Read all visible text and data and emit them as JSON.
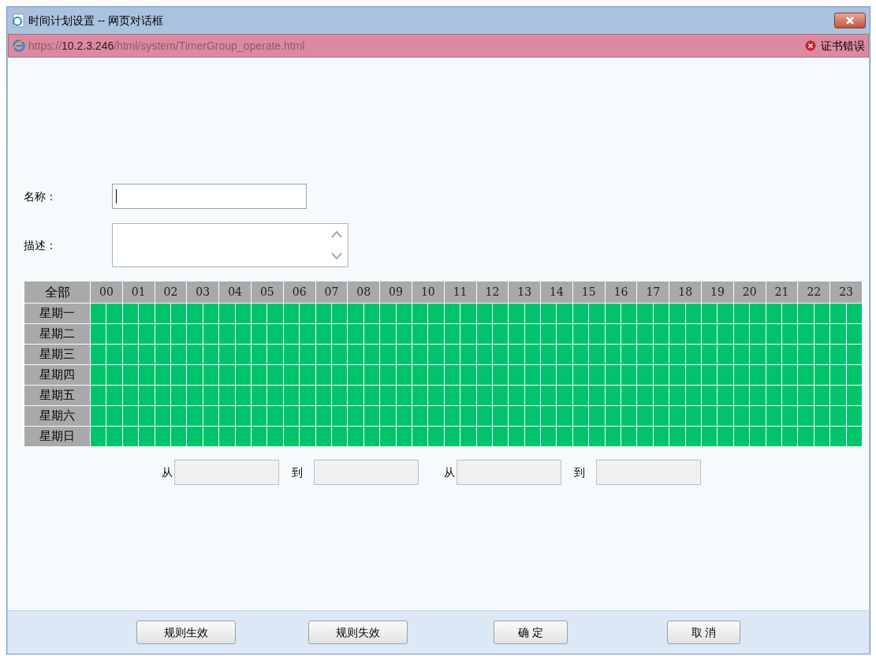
{
  "window": {
    "title": "时间计划设置 -- 网页对话框"
  },
  "address_bar": {
    "scheme": "https://",
    "host": "10.2.3.246",
    "path": "/html/system/TimerGroup_operate.html",
    "warning": "证书错误"
  },
  "form": {
    "name_label": "名称：",
    "name_focused": true,
    "description_label": "描述："
  },
  "schedule": {
    "corner": "全部",
    "hours": [
      "00",
      "01",
      "02",
      "03",
      "04",
      "05",
      "06",
      "07",
      "08",
      "09",
      "10",
      "11",
      "12",
      "13",
      "14",
      "15",
      "16",
      "17",
      "18",
      "19",
      "20",
      "21",
      "22",
      "23"
    ],
    "rows": [
      {
        "label": "星期一",
        "slots": [
          true,
          true,
          true,
          true,
          true,
          true,
          true,
          true,
          true,
          true,
          true,
          true,
          true,
          true,
          true,
          true,
          true,
          true,
          true,
          true,
          true,
          true,
          true,
          true,
          true,
          true,
          true,
          true,
          true,
          true,
          true,
          true,
          true,
          true,
          true,
          true,
          true,
          true,
          true,
          true,
          true,
          true,
          true,
          true,
          true,
          true,
          true,
          true
        ]
      },
      {
        "label": "星期二",
        "slots": [
          true,
          true,
          true,
          true,
          true,
          true,
          true,
          true,
          true,
          true,
          true,
          true,
          true,
          true,
          true,
          true,
          true,
          true,
          true,
          true,
          true,
          true,
          true,
          true,
          true,
          true,
          true,
          true,
          true,
          true,
          true,
          true,
          true,
          true,
          true,
          true,
          true,
          true,
          true,
          true,
          true,
          true,
          true,
          true,
          true,
          true,
          true,
          true
        ]
      },
      {
        "label": "星期三",
        "slots": [
          true,
          true,
          true,
          true,
          true,
          true,
          true,
          true,
          true,
          true,
          true,
          true,
          true,
          true,
          true,
          true,
          true,
          true,
          true,
          true,
          true,
          true,
          true,
          true,
          true,
          true,
          true,
          true,
          true,
          true,
          true,
          true,
          true,
          true,
          true,
          true,
          true,
          true,
          true,
          true,
          true,
          true,
          true,
          true,
          true,
          true,
          true,
          true
        ]
      },
      {
        "label": "星期四",
        "slots": [
          true,
          true,
          true,
          true,
          true,
          true,
          true,
          true,
          true,
          true,
          true,
          true,
          true,
          true,
          true,
          true,
          true,
          true,
          true,
          true,
          true,
          true,
          true,
          true,
          true,
          true,
          true,
          true,
          true,
          true,
          true,
          true,
          true,
          true,
          true,
          true,
          true,
          true,
          true,
          true,
          true,
          true,
          true,
          true,
          true,
          true,
          true,
          true
        ]
      },
      {
        "label": "星期五",
        "slots": [
          true,
          true,
          true,
          true,
          true,
          true,
          true,
          true,
          true,
          true,
          true,
          true,
          true,
          true,
          true,
          true,
          true,
          true,
          true,
          true,
          true,
          true,
          true,
          true,
          true,
          true,
          true,
          true,
          true,
          true,
          true,
          true,
          true,
          true,
          true,
          true,
          true,
          true,
          true,
          true,
          true,
          true,
          true,
          true,
          true,
          true,
          true,
          true
        ]
      },
      {
        "label": "星期六",
        "slots": [
          true,
          true,
          true,
          true,
          true,
          true,
          true,
          true,
          true,
          true,
          true,
          true,
          true,
          true,
          true,
          true,
          true,
          true,
          true,
          true,
          true,
          true,
          true,
          true,
          true,
          true,
          true,
          true,
          true,
          true,
          true,
          true,
          true,
          true,
          true,
          true,
          true,
          true,
          true,
          true,
          true,
          true,
          true,
          true,
          true,
          true,
          true,
          true
        ]
      },
      {
        "label": "星期日",
        "slots": [
          true,
          true,
          true,
          true,
          true,
          true,
          true,
          true,
          true,
          true,
          true,
          true,
          true,
          true,
          true,
          true,
          true,
          true,
          true,
          true,
          true,
          true,
          true,
          true,
          true,
          true,
          true,
          true,
          true,
          true,
          true,
          true,
          true,
          true,
          true,
          true,
          true,
          true,
          true,
          true,
          true,
          true,
          true,
          true,
          true,
          true,
          true,
          true
        ]
      }
    ]
  },
  "ranges": [
    {
      "label": "从",
      "disabled": true
    },
    {
      "label": "到",
      "disabled": true
    },
    {
      "label": "从",
      "disabled": true
    },
    {
      "label": "到",
      "disabled": true
    }
  ],
  "buttons": [
    "规则生效",
    "规则失效",
    "确 定",
    "取 消"
  ]
}
